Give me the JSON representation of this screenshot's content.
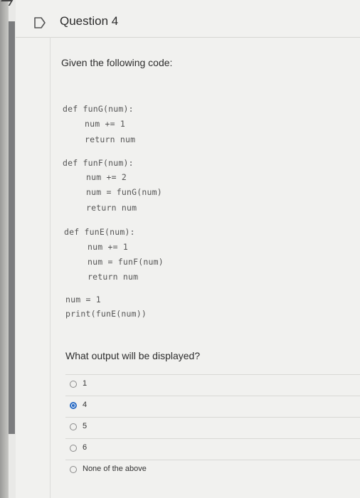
{
  "question": {
    "title": "Question 4",
    "prompt": "Given the following code:",
    "code": {
      "fung": {
        "def": "def funG(num):",
        "body": [
          "num += 1",
          "return num"
        ]
      },
      "funf": {
        "def": "def funF(num):",
        "body": [
          "num += 2",
          "num = funG(num)",
          "return num"
        ]
      },
      "fune": {
        "def": "def funE(num):",
        "body": [
          "num += 1",
          "num = funF(num)",
          "return num"
        ]
      },
      "main": [
        "num = 1",
        "print(funE(num))"
      ]
    },
    "question_text": "What output will be displayed?",
    "options": [
      {
        "label": "1",
        "selected": false
      },
      {
        "label": "4",
        "selected": true
      },
      {
        "label": "5",
        "selected": false
      },
      {
        "label": "6",
        "selected": false
      },
      {
        "label": "None of the above",
        "selected": false
      }
    ]
  }
}
